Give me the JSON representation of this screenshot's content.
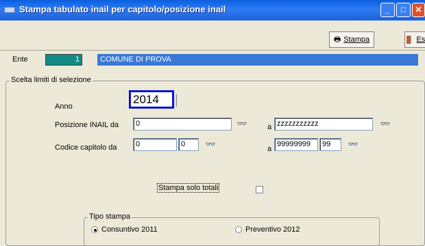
{
  "window": {
    "title": "Stampa tabulato inail per capitolo/posizione inail",
    "controls": [
      "minimize-icon",
      "maximize-icon",
      "close-icon"
    ]
  },
  "toolbar": {
    "stampa_label": "Stampa",
    "esci_label": "Esci"
  },
  "ente": {
    "label": "Ente",
    "code": "1",
    "name": "COMUNE DI PROVA"
  },
  "selezione": {
    "group_label": "Scelta limiti di selezione",
    "anno_label": "Anno",
    "anno_value": "2014",
    "posizione_label": "Posizione INAIL da",
    "posizione_from": "0",
    "a_label": "a",
    "posizione_to": "zzzzzzzzzzz",
    "capitolo_label": "Codice capitolo da",
    "capitolo_from_1": "0",
    "capitolo_from_2": "0",
    "capitolo_to_1": "99999999",
    "capitolo_to_2": "99",
    "stampa_totali_label": "Stampa solo totali",
    "stampa_totali_checked": false
  },
  "tipo_stampa": {
    "group_label": "Tipo stampa",
    "options": [
      {
        "label": "Consuntivo 2011",
        "selected": true
      },
      {
        "label": "Preventivo 2012",
        "selected": false
      }
    ]
  },
  "colors": {
    "titlebar": "#0A5FE0",
    "ente_code_bg": "#138A85",
    "ente_name_bg": "#3A79D6",
    "focus_border": "#0A14D8"
  }
}
